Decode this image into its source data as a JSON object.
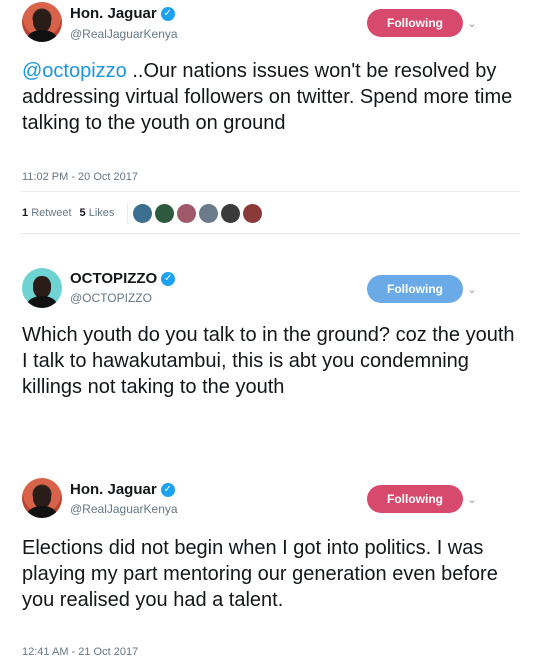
{
  "tweets": [
    {
      "name": "Hon. Jaguar",
      "handle": "@RealJaguarKenya",
      "follow_label": "Following",
      "mention": "@octopizzo",
      "text": " ..Our nations issues won't be resolved by addressing virtual followers on twitter. Spend more time talking to the youth on ground",
      "time": "11:02 PM - 20 Oct 2017",
      "retweets_count": "1",
      "retweets_label": "Retweet",
      "likes_count": "5",
      "likes_label": "Likes"
    },
    {
      "name": "OCTOPIZZO",
      "handle": "@OCTOPIZZO",
      "follow_label": "Following",
      "text": "Which youth do you talk to in the ground? coz the youth I talk to hawakutambui, this is abt you condemning killings not taking to the youth"
    },
    {
      "name": "Hon. Jaguar",
      "handle": "@RealJaguarKenya",
      "follow_label": "Following",
      "text": "Elections did not begin when I got into politics. I was playing my part mentoring our generation even before you realised you had a talent.",
      "time": "12:41 AM - 21 Oct 2017"
    }
  ],
  "colors": {
    "follow_red": "#d84a6d",
    "follow_blue": "#6aaae6",
    "mention": "#1b95e0",
    "verified": "#1da1f2"
  },
  "icons": {
    "verified": "verified-badge-icon",
    "caret": "chevron-down-icon"
  },
  "liker_colors": [
    "#3b6e8f",
    "#2d5a3d",
    "#a0586b",
    "#6b7b8c",
    "#3a3a3a",
    "#8b3a3a"
  ]
}
